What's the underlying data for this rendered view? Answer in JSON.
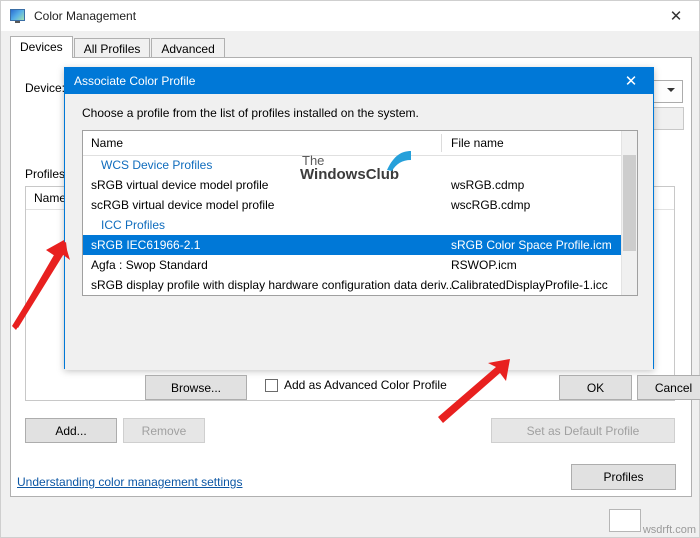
{
  "window": {
    "title": "Color Management",
    "icon": "monitor-icon",
    "close_label": "✕",
    "tabs": [
      {
        "label": "Devices",
        "active": true
      },
      {
        "label": "All Profiles",
        "active": false
      },
      {
        "label": "Advanced",
        "active": false
      }
    ],
    "device_label": "Device:",
    "profiles_label": "Profiles",
    "profiles_column_header": "Name",
    "buttons": {
      "add": "Add...",
      "remove": "Remove",
      "set_default": "Set as Default Profile",
      "profiles": "Profiles"
    },
    "link": "Understanding color management settings"
  },
  "dialog": {
    "title": "Associate Color Profile",
    "close_label": "✕",
    "instruction": "Choose a profile from the list of profiles installed on the system.",
    "columns": {
      "name": "Name",
      "file_name": "File name"
    },
    "rows": [
      {
        "type": "group",
        "name": "WCS Device Profiles",
        "file": ""
      },
      {
        "type": "item",
        "name": "sRGB virtual device model profile",
        "file": "wsRGB.cdmp",
        "selected": false
      },
      {
        "type": "item",
        "name": "scRGB virtual device model profile",
        "file": "wscRGB.cdmp",
        "selected": false
      },
      {
        "type": "group",
        "name": "ICC Profiles",
        "file": ""
      },
      {
        "type": "item",
        "name": "sRGB IEC61966-2.1",
        "file": "sRGB Color Space Profile.icm",
        "selected": true
      },
      {
        "type": "item",
        "name": "Agfa : Swop Standard",
        "file": "RSWOP.icm",
        "selected": false
      },
      {
        "type": "item",
        "name": "sRGB display profile with display hardware configuration data deriv...",
        "file": "CalibratedDisplayProfile-1.icc",
        "selected": false
      }
    ],
    "browse_button": "Browse...",
    "checkbox_label": "Add as Advanced Color Profile",
    "checkbox_checked": false,
    "ok_button": "OK",
    "cancel_button": "Cancel"
  },
  "watermark": {
    "line1": "The",
    "line2": "WindowsClub",
    "bottom": "wsdrft.com"
  },
  "colors": {
    "accent": "#0078d7",
    "selection": "#0078d7",
    "link": "#0b56a4",
    "arrow": "#e8201f",
    "group_text": "#0f6cbd"
  }
}
